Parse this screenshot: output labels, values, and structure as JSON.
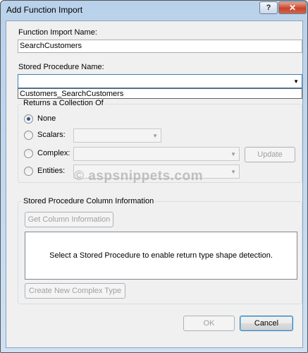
{
  "window": {
    "title": "Add Function Import",
    "help_symbol": "?",
    "close_symbol": "✕"
  },
  "function_import_name": {
    "label": "Function Import Name:",
    "value": "SearchCustomers"
  },
  "stored_procedure": {
    "label": "Stored Procedure Name:",
    "value": "",
    "dropdown_items": [
      "Customers_SearchCustomers"
    ]
  },
  "returns_group": {
    "title": "Returns a Collection Of",
    "options": [
      {
        "label": "None",
        "checked": true
      },
      {
        "label": "Scalars:",
        "checked": false
      },
      {
        "label": "Complex:",
        "checked": false
      },
      {
        "label": "Entities:",
        "checked": false
      }
    ],
    "update_button": "Update"
  },
  "column_info_group": {
    "title": "Stored Procedure Column Information",
    "get_column_button": "Get Column Information",
    "message": "Select a Stored Procedure to enable return type shape detection.",
    "create_complex_button": "Create New Complex Type"
  },
  "footer": {
    "ok_label": "OK",
    "cancel_label": "Cancel"
  },
  "watermark": "© aspsnippets.com",
  "colors": {
    "accent": "#3c7fb1",
    "dialog_bg": "#f0f0f0",
    "title_bar": "#c4daf0"
  },
  "icons": {
    "help": "help-icon",
    "close": "close-icon",
    "dropdown": "chevron-down-icon"
  }
}
